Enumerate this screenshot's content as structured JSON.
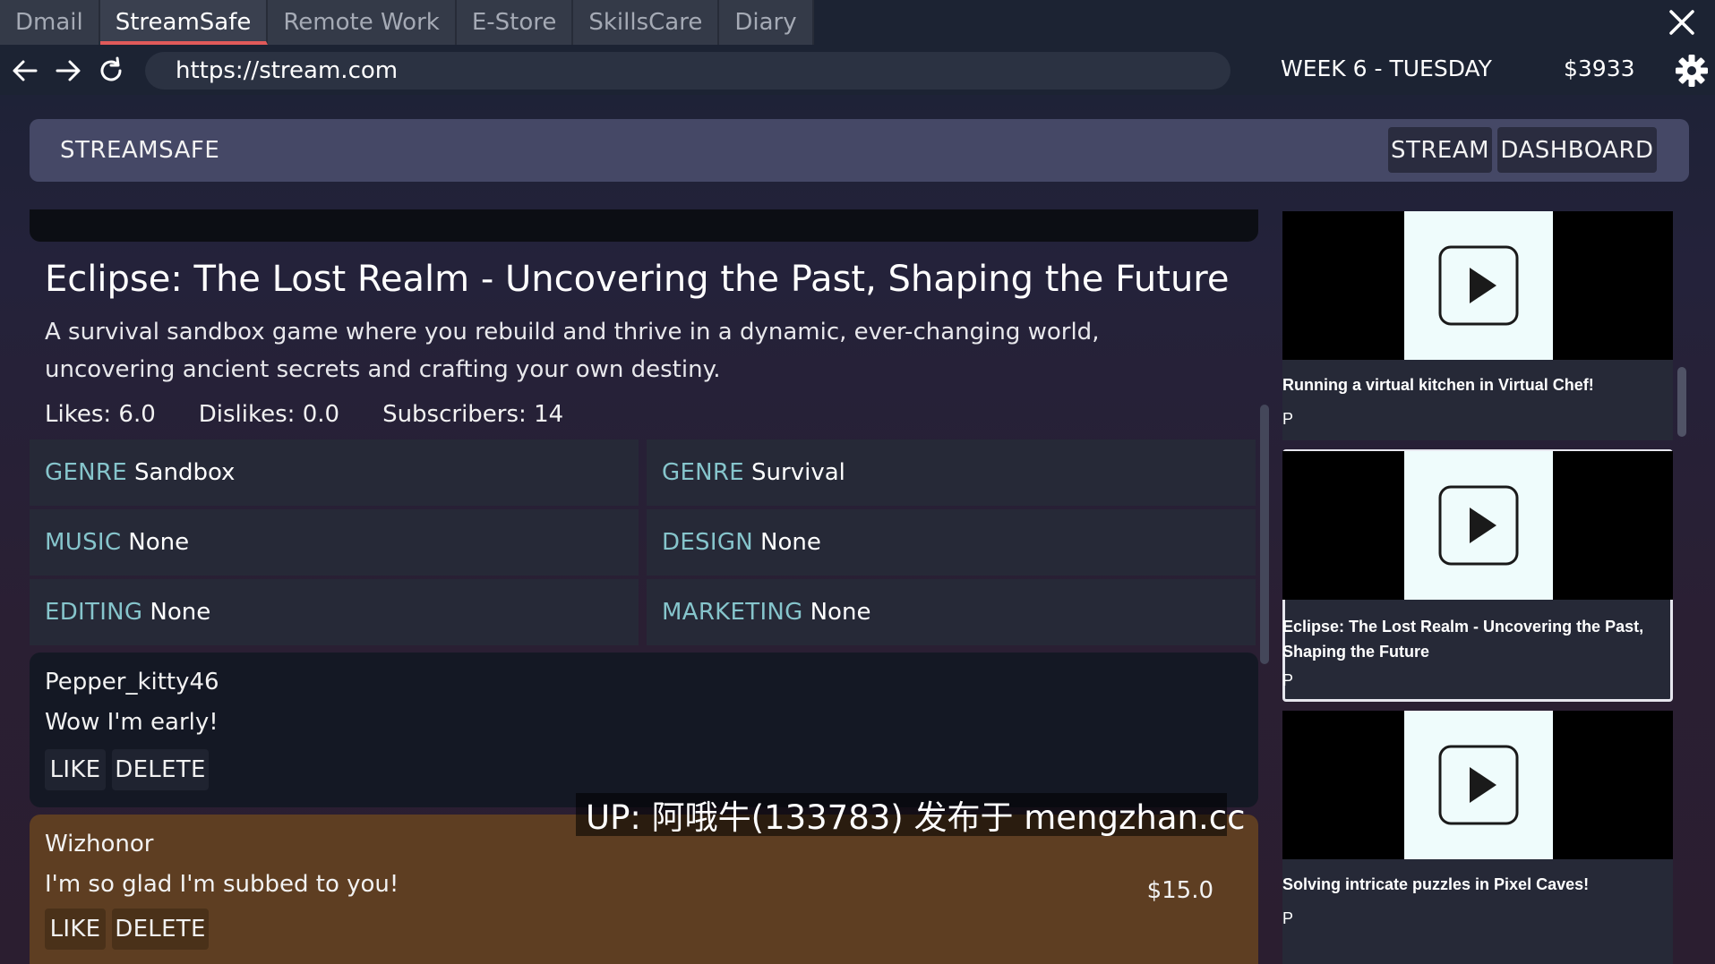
{
  "tabs": [
    {
      "label": "Dmail"
    },
    {
      "label": "StreamSafe"
    },
    {
      "label": "Remote Work"
    },
    {
      "label": "E-Store"
    },
    {
      "label": "SkillsCare"
    },
    {
      "label": "Diary"
    }
  ],
  "active_tab": "StreamSafe",
  "nav": {
    "url": "https://stream.com",
    "week": "WEEK 6 - TUESDAY",
    "money": "$3933"
  },
  "app": {
    "brand": "STREAMSAFE",
    "stream_button": "STREAM",
    "dashboard_button": "DASHBOARD"
  },
  "stream": {
    "title": "Eclipse: The Lost Realm - Uncovering the Past, Shaping the Future",
    "description": "A survival sandbox game where you rebuild and thrive in a dynamic, ever-changing world, uncovering ancient secrets and crafting your own destiny.",
    "likes": "Likes: 6.0",
    "dislikes": "Dislikes: 0.0",
    "subscribers": "Subscribers: 14",
    "attributes": [
      {
        "key": "GENRE",
        "value": "Sandbox"
      },
      {
        "key": "GENRE",
        "value": "Survival"
      },
      {
        "key": "MUSIC",
        "value": "None"
      },
      {
        "key": "DESIGN",
        "value": "None"
      },
      {
        "key": "EDITING",
        "value": "None"
      },
      {
        "key": "MARKETING",
        "value": "None"
      }
    ]
  },
  "comments": [
    {
      "user": "Pepper_kitty46",
      "message": "Wow I'm early!",
      "like_label": "LIKE",
      "delete_label": "DELETE",
      "donation": ""
    },
    {
      "user": "Wizhonor",
      "message": "I'm so glad I'm subbed to you!",
      "like_label": "LIKE",
      "delete_label": "DELETE",
      "donation": "$15.0"
    }
  ],
  "watermark": "UP: 阿哦牛(133783) 发布于 mengzhan.cc",
  "sidebar": [
    {
      "title": "Running a virtual kitchen in Virtual Chef!",
      "sub": "P"
    },
    {
      "title": "Eclipse: The Lost Realm - Uncovering the Past, Shaping the Future",
      "sub": "P"
    },
    {
      "title": "Solving intricate puzzles in Pixel Caves!",
      "sub": "P"
    }
  ],
  "colors": {
    "accent_tab_underline": "#e05a5a",
    "attribute_key": "#86c5cc",
    "donation_comment_bg": "#5e3e22",
    "header_bg": "#454866"
  },
  "icons": [
    "back-arrow-icon",
    "forward-arrow-icon",
    "reload-icon",
    "gear-icon",
    "close-icon",
    "play-icon"
  ]
}
